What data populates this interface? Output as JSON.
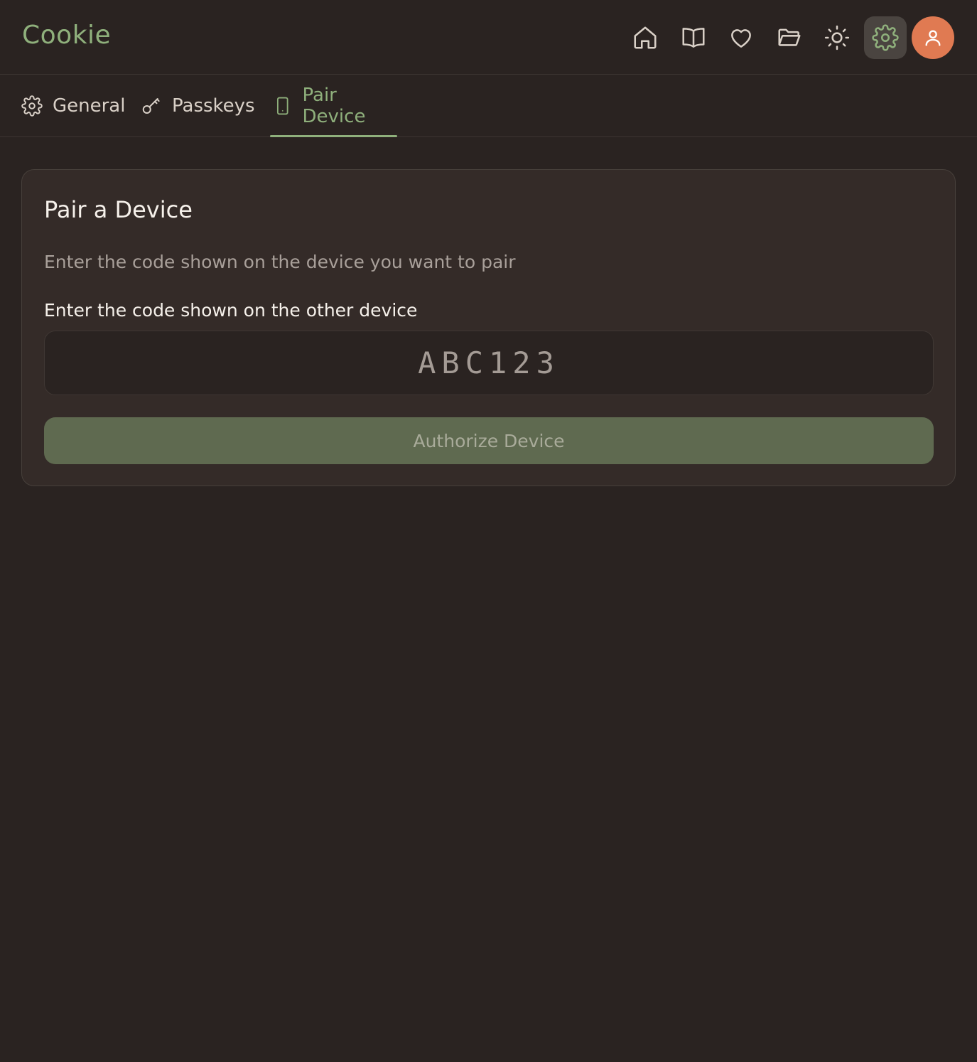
{
  "header": {
    "brand": "Cookie",
    "nav": [
      {
        "icon": "home-icon"
      },
      {
        "icon": "book-icon"
      },
      {
        "icon": "heart-icon"
      },
      {
        "icon": "folder-icon"
      },
      {
        "icon": "sun-icon"
      },
      {
        "icon": "gear-icon",
        "active": true
      }
    ],
    "avatar_icon": "user-icon"
  },
  "tabs": [
    {
      "label": "General",
      "icon": "gear-icon"
    },
    {
      "label": "Passkeys",
      "icon": "key-icon"
    },
    {
      "label": "Pair Device",
      "icon": "smartphone-icon",
      "active": true
    }
  ],
  "card": {
    "title": "Pair a Device",
    "description": "Enter the code shown on the device you want to pair",
    "field_label": "Enter the code shown on the other device",
    "code_placeholder": "ABC123",
    "code_value": "",
    "button_label": "Authorize Device"
  },
  "colors": {
    "background": "#2a2321",
    "card": "#342b28",
    "accent": "#8fb07c",
    "avatar": "#e07a52",
    "button": "#5f6a50"
  }
}
